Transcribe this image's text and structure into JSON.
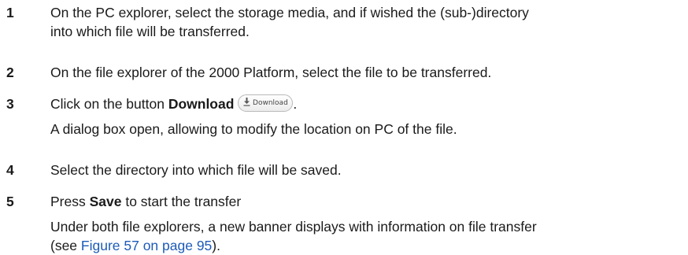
{
  "steps": [
    {
      "number": "1",
      "lines": [
        "On the PC explorer, select the storage media, and if wished the (sub-)directory",
        "into which file will be transferred."
      ]
    },
    {
      "number": "2",
      "text": "On the file explorer of the 2000 Platform, select the file to be transferred."
    },
    {
      "number": "3",
      "prefix": "Click on the button ",
      "bold": "Download",
      "button_label": "Download",
      "suffix": ".",
      "note": "A dialog box open, allowing to modify the location on PC of the file."
    },
    {
      "number": "4",
      "text": "Select the directory into which file will be saved."
    },
    {
      "number": "5",
      "prefix": "Press ",
      "bold": "Save",
      "suffix": " to start the transfer",
      "note_line1": "Under both file explorers, a new banner displays with information on file transfer",
      "note_line2_prefix": "(see ",
      "note_link": "Figure 57 on page 95",
      "note_line2_suffix": ")."
    }
  ],
  "icons": {
    "download": "download-arrow-icon"
  },
  "colors": {
    "text": "#1a1a1a",
    "link": "#1d5bb8"
  }
}
